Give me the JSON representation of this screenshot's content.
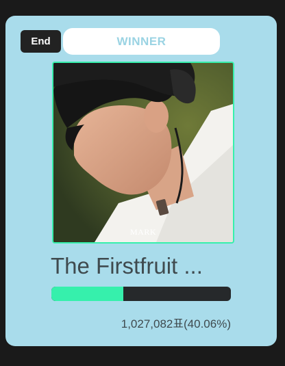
{
  "card": {
    "status_label": "End",
    "winner_label": "WINNER",
    "album_art_caption": "MARK",
    "song_title": "The Firstfruit ...",
    "vote_text": "1,027,082표(40.06%)",
    "vote_progress_percent": 40.06
  },
  "colors": {
    "card_bg": "#a9dceb",
    "accent": "#36f0ac",
    "status_bg": "#222222",
    "winner_text": "#9ad3e3"
  }
}
